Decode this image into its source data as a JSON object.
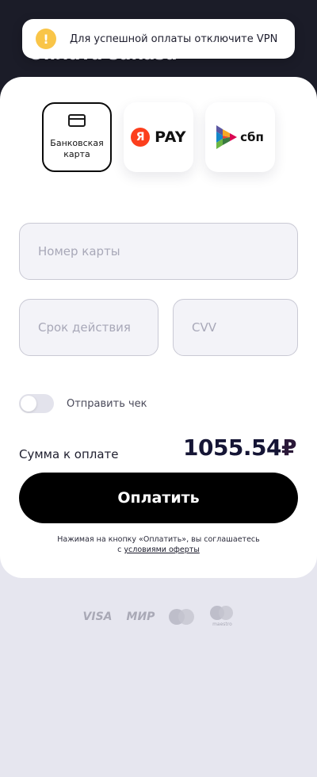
{
  "header": {
    "title": "Оплата заказа"
  },
  "toast": {
    "text": "Для успешной оплаты отключите VPN",
    "icon": "warning-icon"
  },
  "payment_methods": [
    {
      "label": "Банковская карта",
      "selected": true,
      "icon": "bank-card-icon"
    },
    {
      "label": "PAY",
      "logo": "Я",
      "selected": false,
      "icon": "yandex-pay-logo"
    },
    {
      "label": "сбп",
      "selected": false,
      "icon": "sbp-logo"
    }
  ],
  "form": {
    "card_number_placeholder": "Номер карты",
    "expiry_placeholder": "Срок действия",
    "cvv_placeholder": "CVV"
  },
  "receipt": {
    "label": "Отправить чек",
    "enabled": false
  },
  "summary": {
    "label": "Сумма к оплате",
    "amount": "1055.54",
    "currency": "₽"
  },
  "pay_button": {
    "label": "Оплатить"
  },
  "legal": {
    "text": "Нажимая на кнопку «Оплатить», вы соглашаетесь с ",
    "link": "условиями оферты"
  },
  "brands": {
    "visa": "VISA",
    "mir": "МИР",
    "maestro": "maestro"
  },
  "colors": {
    "accent": "#000000",
    "warning": "#f9c548",
    "yandex": "#fc3f1d",
    "dark_bg": "#1b1c28"
  }
}
